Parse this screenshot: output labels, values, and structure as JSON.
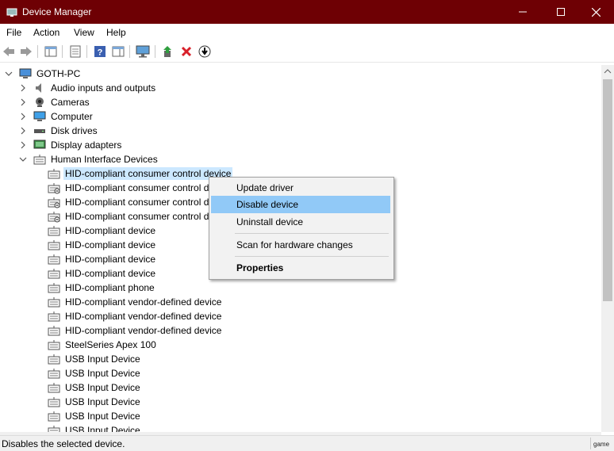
{
  "window": {
    "title": "Device Manager"
  },
  "menubar": {
    "items": [
      "File",
      "Action",
      "View",
      "Help"
    ]
  },
  "toolbar": {
    "buttons": [
      "back-icon",
      "forward-icon",
      "show-hide-console-tree-icon",
      "properties-icon",
      "help-icon",
      "action-pane-icon",
      "monitor-icon",
      "update-driver-icon",
      "uninstall-icon",
      "disable-icon"
    ]
  },
  "tree": {
    "root": "GOTH-PC",
    "categories": [
      {
        "label": "Audio inputs and outputs",
        "icon": "speaker-icon"
      },
      {
        "label": "Cameras",
        "icon": "camera-icon"
      },
      {
        "label": "Computer",
        "icon": "computer-icon"
      },
      {
        "label": "Disk drives",
        "icon": "disk-icon"
      },
      {
        "label": "Display adapters",
        "icon": "display-adapter-icon"
      },
      {
        "label": "Human Interface Devices",
        "icon": "hid-icon"
      }
    ],
    "hid_devices": [
      "HID-compliant consumer control device",
      "HID-compliant consumer control d",
      "HID-compliant consumer control d",
      "HID-compliant consumer control d",
      "HID-compliant device",
      "HID-compliant device",
      "HID-compliant device",
      "HID-compliant device",
      "HID-compliant phone",
      "HID-compliant vendor-defined device",
      "HID-compliant vendor-defined device",
      "HID-compliant vendor-defined device",
      "SteelSeries Apex 100",
      "USB Input Device",
      "USB Input Device",
      "USB Input Device",
      "USB Input Device",
      "USB Input Device",
      "USB Input Device"
    ]
  },
  "context_menu": {
    "update_driver": "Update driver",
    "disable_device": "Disable device",
    "uninstall_device": "Uninstall device",
    "scan": "Scan for hardware changes",
    "properties": "Properties"
  },
  "status": {
    "text": "Disables the selected device.",
    "right": "game"
  },
  "colors": {
    "titlebar": "#6e0004",
    "selection": "#cce8ff",
    "menu_highlight": "#91c9f7"
  }
}
